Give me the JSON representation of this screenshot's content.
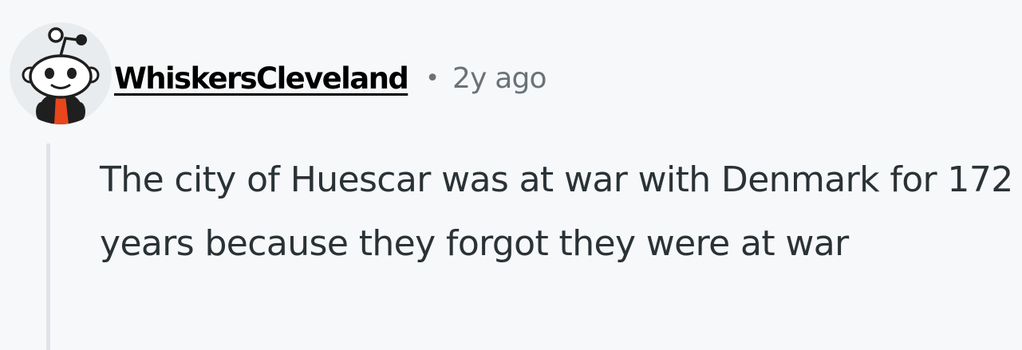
{
  "comment": {
    "author": "WhiskersCleveland",
    "separator": "•",
    "time_ago": "2y ago",
    "body": "The city of Huescar was at war with Denmark for 172 years because they forgot they were at war"
  },
  "avatar": {
    "icon": "snoo-avatar-icon",
    "background_color": "#e9ecee",
    "shirt_color": "#e8461c"
  },
  "colors": {
    "page_background": "#f6f8fa",
    "username": "#000000",
    "meta_text": "#6a7278",
    "body_text": "#2a3236",
    "thread_line": "#dfe3e8"
  }
}
